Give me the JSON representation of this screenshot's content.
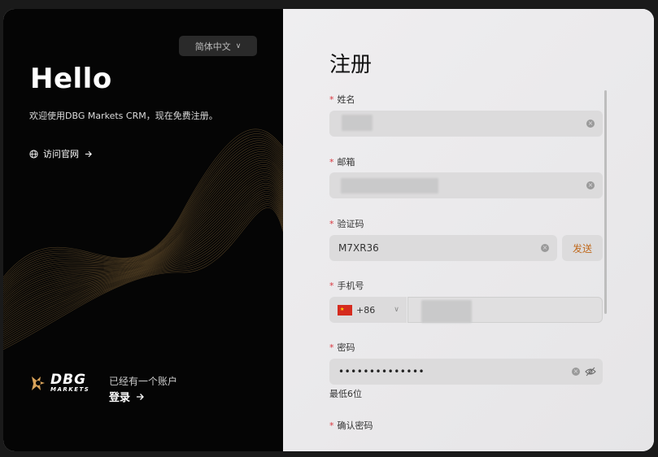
{
  "left": {
    "language": "简体中文",
    "hello": "Hello",
    "subtitle": "欢迎使用DBG Markets CRM，现在免费注册。",
    "visit_site": "访问官网",
    "logo_main": "DBG",
    "logo_sub": "MARKETS",
    "have_account": "已经有一个账户",
    "login": "登录"
  },
  "form": {
    "title": "注册",
    "name_label": "姓名",
    "email_label": "邮箱",
    "code_label": "验证码",
    "code_value": "M7XR36",
    "send_label": "发送",
    "phone_label": "手机号",
    "phone_code": "+86",
    "password_label": "密码",
    "password_value": "••••••••••••••",
    "password_hint": "最低6位",
    "confirm_label": "确认密码"
  },
  "colors": {
    "accent": "#c06a1e",
    "required_star": "#d9363e",
    "left_bg": "#050505"
  }
}
